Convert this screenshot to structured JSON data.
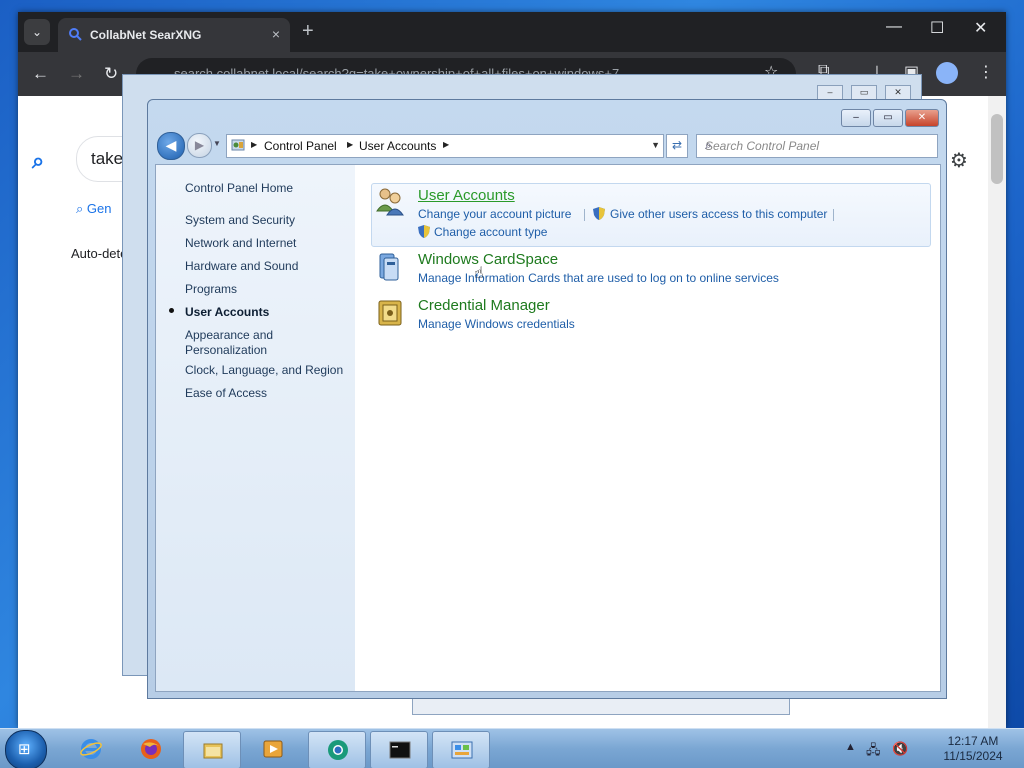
{
  "browser": {
    "tab_title": "CollabNet SearXNG",
    "tab_close": "×",
    "new_tab": "+",
    "url": "search.collabnet.local/search?q=take+ownership+of+all+files+on+windows+7",
    "search_query": "take",
    "tab_general": "Gen",
    "auto_detect": "Auto-dete"
  },
  "control_panel": {
    "breadcrumb": [
      "Control Panel",
      "User Accounts"
    ],
    "search_placeholder": "Search Control Panel",
    "sidebar": {
      "home": "Control Panel Home",
      "items": [
        "System and Security",
        "Network and Internet",
        "Hardware and Sound",
        "Programs",
        "User Accounts",
        "Appearance and",
        "Personalization",
        "Clock, Language, and Region",
        "Ease of Access"
      ],
      "active_index": 4
    },
    "categories": {
      "user_accounts": {
        "title": "User Accounts",
        "links": [
          "Change your account picture",
          "Give other users access to this computer",
          "Change account type"
        ]
      },
      "cardspace": {
        "title": "Windows CardSpace",
        "links": [
          "Manage Information Cards that are used to log on to online services"
        ]
      },
      "credential_manager": {
        "title": "Credential Manager",
        "links": [
          "Manage Windows credentials"
        ]
      }
    }
  },
  "taskbar": {
    "clock_time": "12:17 AM",
    "clock_date": "11/15/2024",
    "apps": [
      "internet-explorer",
      "firefox",
      "file-explorer",
      "media-player",
      "chrome",
      "command-prompt",
      "control-panel"
    ]
  },
  "colors": {
    "category_title": "#1e7a1e",
    "link": "#1f5ea8",
    "taskbar": "#7aa6d3"
  }
}
